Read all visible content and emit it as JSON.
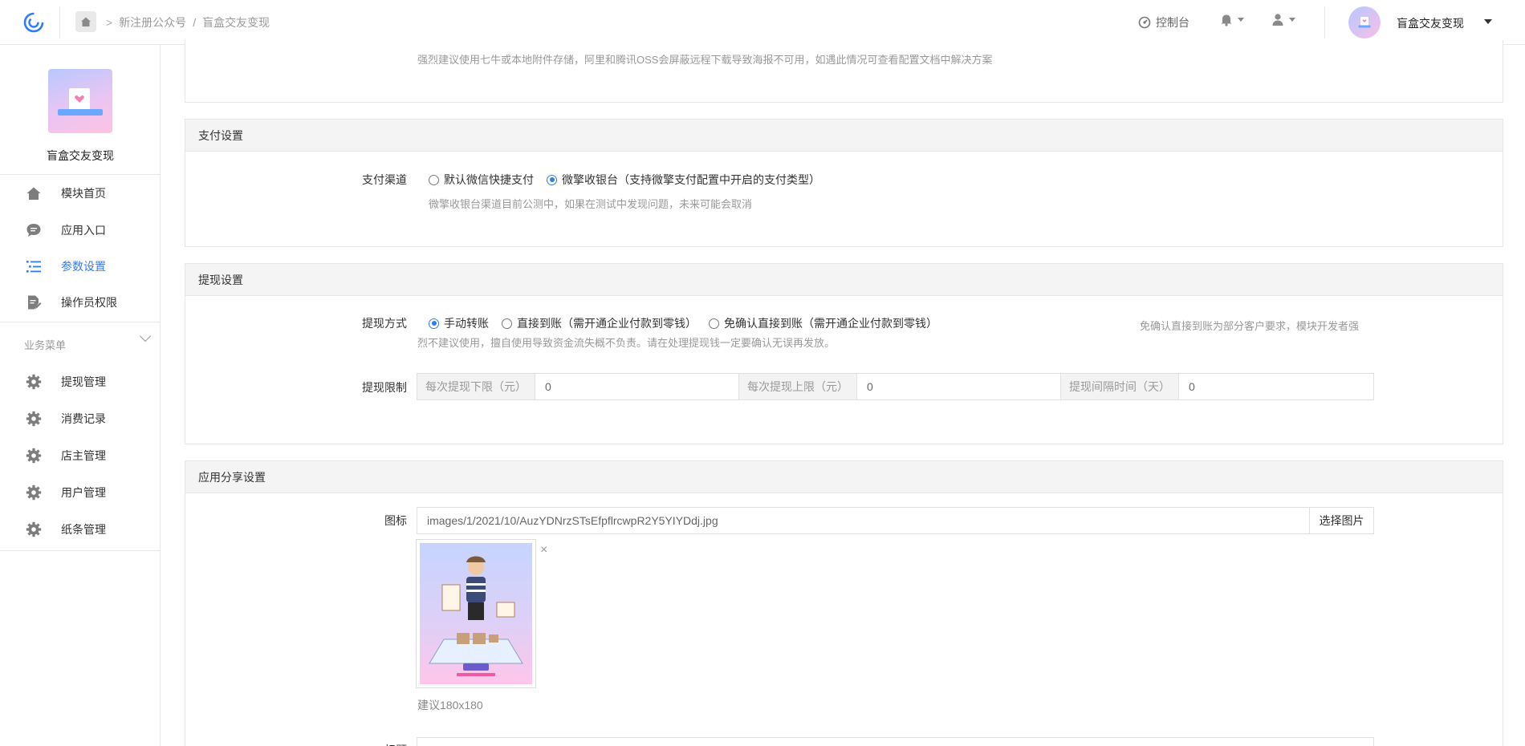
{
  "breadcrumb": {
    "account": "新注册公众号",
    "sep": "/",
    "module": "盲盒交友变现"
  },
  "topbar": {
    "console_label": "控制台",
    "account_name": "盲盒交友变现"
  },
  "sidebar": {
    "title": "盲盒交友变现",
    "items": [
      {
        "label": "模块首页",
        "icon": "home-icon"
      },
      {
        "label": "应用入口",
        "icon": "chat-bubble-icon"
      },
      {
        "label": "参数设置",
        "icon": "list-icon",
        "active": true
      },
      {
        "label": "操作员权限",
        "icon": "document-edit-icon"
      }
    ],
    "business_menu_label": "业务菜单",
    "business_items": [
      {
        "label": "提现管理",
        "icon": "gear-icon"
      },
      {
        "label": "消费记录",
        "icon": "gear-icon"
      },
      {
        "label": "店主管理",
        "icon": "gear-icon"
      },
      {
        "label": "用户管理",
        "icon": "gear-icon"
      },
      {
        "label": "纸条管理",
        "icon": "gear-icon"
      }
    ]
  },
  "storage_panel": {
    "help": "强烈建议使用七牛或本地附件存储，阿里和腾讯OSS会屏蔽远程下载导致海报不可用，如遇此情况可查看配置文档中解决方案"
  },
  "payment_panel": {
    "title": "支付设置",
    "channel_label": "支付渠道",
    "options": [
      "默认微信快捷支付",
      "微擎收银台（支持微擎支付配置中开启的支付类型）"
    ],
    "selected_index": 1,
    "help": "微擎收银台渠道目前公测中，如果在测试中发现问题，未来可能会取消"
  },
  "withdraw_panel": {
    "title": "提现设置",
    "method_label": "提现方式",
    "options": [
      "手动转账",
      "直接到账（需开通企业付款到零钱）",
      "免确认直接到账（需开通企业付款到零钱）"
    ],
    "selected_index": 0,
    "help_line1": "免确认直接到账为部分客户要求，模块开发者强",
    "help_line2": "烈不建议使用，擅自使用导致资金流失概不负责。请在处理提现钱一定要确认无误再发放。",
    "limit_label": "提现限制",
    "limits": [
      {
        "addon": "每次提现下限（元）",
        "value": "0"
      },
      {
        "addon": "每次提现上限（元）",
        "value": "0"
      },
      {
        "addon": "提现间隔时间（天）",
        "value": "0"
      }
    ]
  },
  "share_panel": {
    "title": "应用分享设置",
    "icon_label": "图标",
    "icon_path": "images/1/2021/10/AuzYDNrzSTsEfpflrcwpR2Y5YIYDdj.jpg",
    "choose_button": "选择图片",
    "remove_symbol": "×",
    "size_hint": "建议180x180",
    "next_label": "标题"
  }
}
